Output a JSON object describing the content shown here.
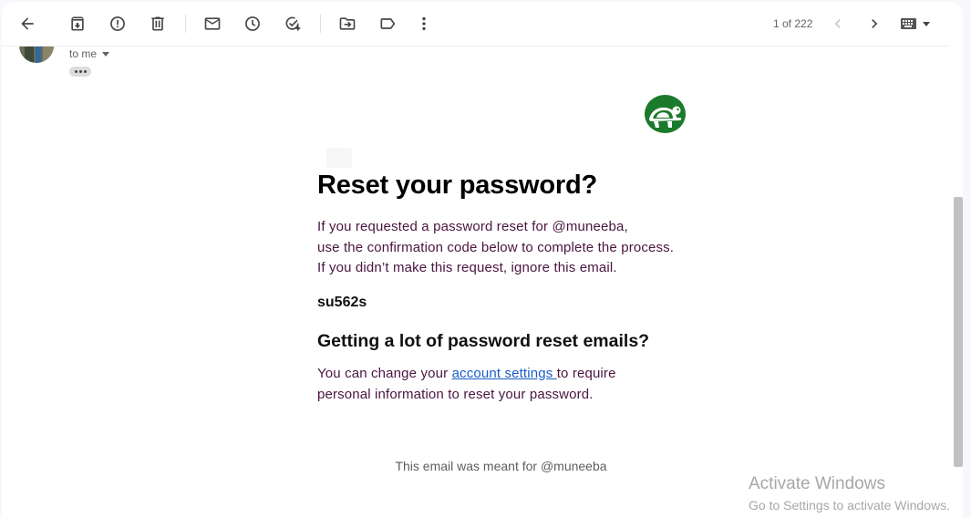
{
  "toolbar": {
    "buttons": [
      {
        "name": "back",
        "icon": "arrow-left-icon"
      },
      {
        "name": "archive",
        "icon": "archive-icon"
      },
      {
        "name": "report-spam",
        "icon": "report-icon"
      },
      {
        "name": "delete",
        "icon": "trash-icon"
      },
      {
        "name": "mark-unread",
        "icon": "mail-icon"
      },
      {
        "name": "snooze",
        "icon": "clock-icon"
      },
      {
        "name": "add-to-tasks",
        "icon": "task-add-icon"
      },
      {
        "name": "move-to",
        "icon": "folder-move-icon"
      },
      {
        "name": "labels",
        "icon": "label-icon"
      },
      {
        "name": "more",
        "icon": "more-vert-icon"
      }
    ],
    "pager": "1 of 222",
    "input_tools_icon": "keyboard-icon"
  },
  "header": {
    "recipient": "to me",
    "trimmed_content_icon": "ellipsis-icon"
  },
  "email": {
    "title": "Reset your password?",
    "intro_lines": [
      "If you requested a password reset for @muneeba,",
      "use the confirmation code below to complete the process.",
      "If you didn’t make this request, ignore this email."
    ],
    "code": "su562s",
    "subheading": "Getting a lot of password reset emails?",
    "para_before_link": "You can change your ",
    "link_text": "account settings ",
    "para_after_link": "to require",
    "para_line2": "personal information to reset your password.",
    "footer": "This email was meant for @muneeba"
  },
  "watermark": {
    "line1": "Activate Windows",
    "line2": "Go to Settings to activate Windows."
  },
  "colors": {
    "body_text": "#4a1540",
    "link": "#1a5cc8",
    "logo_green": "#1b7a2b",
    "icon_gray": "#444746"
  }
}
